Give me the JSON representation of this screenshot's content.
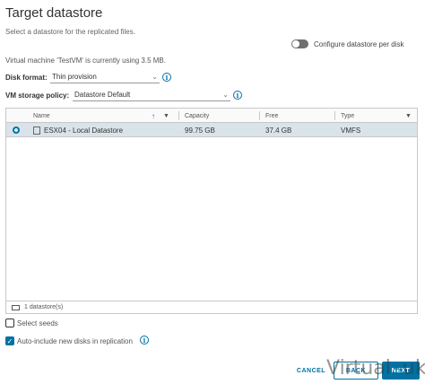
{
  "dialog": {
    "title": "Target datastore",
    "subtitle": "Select a datastore for the replicated files.",
    "toggle_label": "Configure datastore per disk",
    "usage_text": "Virtual machine 'TestVM' is currently using 3.5 MB."
  },
  "disk_format": {
    "label": "Disk format:",
    "value": "Thin provision"
  },
  "storage_policy": {
    "label": "VM storage policy:",
    "value": "Datastore Default"
  },
  "grid": {
    "columns": [
      "Name",
      "Capacity",
      "Free",
      "Type"
    ],
    "rows": [
      {
        "name": "ESX04 - Local Datastore",
        "capacity": "99.75 GB",
        "free": "37.4 GB",
        "type": "VMFS",
        "selected": true
      }
    ],
    "footer": "1 datastore(s)"
  },
  "options": {
    "select_seeds": "Select seeds",
    "auto_include": "Auto-include new disks in replication"
  },
  "buttons": {
    "cancel": "CANCEL",
    "back": "BACK",
    "next": "NEXT"
  },
  "watermark": {
    "part1": "Virtual",
    "part2": "uk"
  },
  "colors": {
    "accent": "#0072a3",
    "selected_row": "#d9e4ea"
  }
}
